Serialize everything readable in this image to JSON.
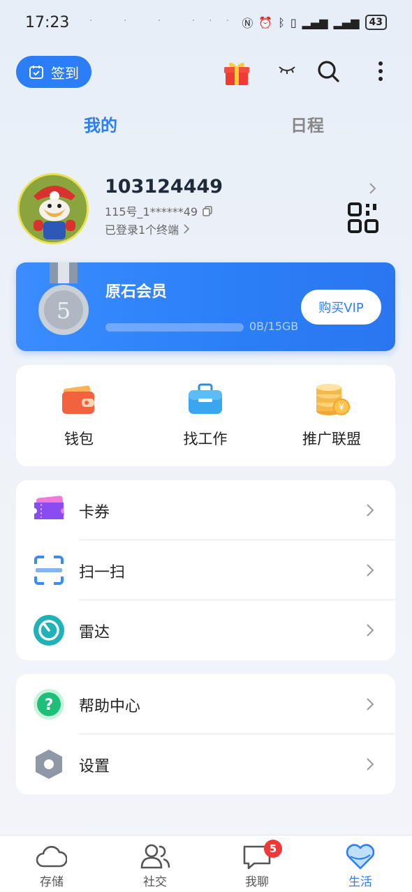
{
  "status": {
    "time": "17:23",
    "battery": "43"
  },
  "topbar": {
    "signin_label": "签到"
  },
  "tabs": [
    {
      "label": "我的"
    },
    {
      "label": "日程"
    }
  ],
  "profile": {
    "username": "103124449",
    "account_id": "115号_1******49",
    "terminal_status": "已登录1个终端"
  },
  "vip": {
    "title": "原石会员",
    "storage": "0B/15GB",
    "storage_used_fraction": 0,
    "medal_level": "5",
    "buy_label": "购买VIP"
  },
  "quick_actions": [
    {
      "label": "钱包",
      "icon": "wallet-icon"
    },
    {
      "label": "找工作",
      "icon": "briefcase-icon"
    },
    {
      "label": "推广联盟",
      "icon": "coins-icon"
    }
  ],
  "menu_group1": [
    {
      "label": "卡券",
      "icon": "ticket-icon"
    },
    {
      "label": "扫一扫",
      "icon": "scan-icon"
    },
    {
      "label": "雷达",
      "icon": "radar-icon"
    }
  ],
  "menu_group2": [
    {
      "label": "帮助中心",
      "icon": "help-icon"
    },
    {
      "label": "设置",
      "icon": "settings-icon"
    }
  ],
  "bottom_nav": [
    {
      "label": "存储",
      "icon": "cloud-icon"
    },
    {
      "label": "社交",
      "icon": "people-icon"
    },
    {
      "label": "我聊",
      "icon": "chat-icon",
      "badge": "5"
    },
    {
      "label": "生活",
      "icon": "heart-icon",
      "active": true
    }
  ],
  "colors": {
    "accent": "#2b7ef7",
    "badge": "#f03838"
  }
}
